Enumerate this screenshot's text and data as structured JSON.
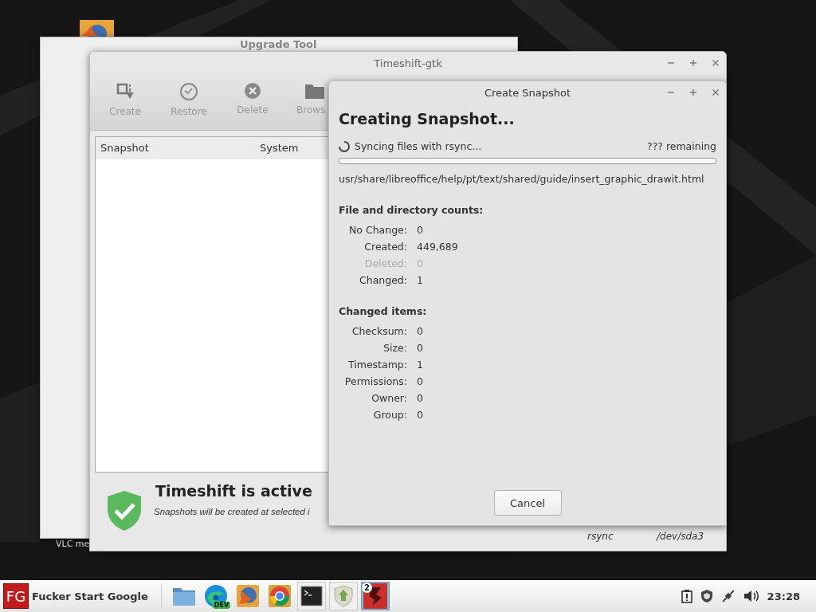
{
  "desktop": {
    "icons": [
      {
        "label": "VLC me"
      }
    ]
  },
  "upgrade_window": {
    "title": "Upgrade Tool"
  },
  "timeshift_window": {
    "title": "Timeshift-gtk",
    "toolbar": [
      {
        "kind": "create",
        "label": "Create",
        "disabled": true
      },
      {
        "kind": "restore",
        "label": "Restore",
        "disabled": true
      },
      {
        "kind": "delete",
        "label": "Delete",
        "disabled": true
      },
      {
        "kind": "browse",
        "label": "Brows",
        "disabled": true
      }
    ],
    "table": {
      "columns": [
        "Snapshot",
        "System"
      ]
    },
    "status": {
      "title": "Timeshift is active",
      "message": "Snapshots will be created at selected i",
      "mode": "rsync",
      "device": "/dev/sda3"
    }
  },
  "dialog": {
    "title": "Create Snapshot",
    "heading": "Creating Snapshot...",
    "activity": "Syncing files with rsync...",
    "remaining": "??? remaining",
    "progress": {
      "level": 0
    },
    "current_file": "usr/share/libreoffice/help/pt/text/shared/guide/insert_graphic_drawit.html",
    "sections": [
      {
        "title": "File and directory counts:",
        "rows": [
          {
            "label": "No Change:",
            "value": "0",
            "disabled": false
          },
          {
            "label": "Created:",
            "value": "449,689",
            "disabled": false
          },
          {
            "label": "Deleted:",
            "value": "0",
            "disabled": true
          },
          {
            "label": "Changed:",
            "value": "1",
            "disabled": false
          }
        ]
      },
      {
        "title": "Changed items:",
        "rows": [
          {
            "label": "Checksum:",
            "value": "0",
            "disabled": false
          },
          {
            "label": "Size:",
            "value": "0",
            "disabled": false
          },
          {
            "label": "Timestamp:",
            "value": "1",
            "disabled": false
          },
          {
            "label": "Permissions:",
            "value": "0",
            "disabled": false
          },
          {
            "label": "Owner:",
            "value": "0",
            "disabled": false
          },
          {
            "label": "Group:",
            "value": "0",
            "disabled": false
          }
        ]
      }
    ],
    "buttons": [
      "Cancel"
    ]
  },
  "taskbar": {
    "start": {
      "logo": "FG",
      "label": "Fucker Start Google"
    },
    "launchers": [
      {
        "kind": "folder",
        "running": false,
        "selected": false
      },
      {
        "kind": "edge",
        "badge": "DEV",
        "running": false,
        "selected": false
      },
      {
        "kind": "firefox",
        "running": false,
        "selected": false
      },
      {
        "kind": "chrome",
        "running": false,
        "selected": false
      },
      {
        "kind": "terminal",
        "running": true,
        "selected": false
      },
      {
        "kind": "updater",
        "running": true,
        "selected": false
      },
      {
        "kind": "app",
        "count": "2",
        "running": true,
        "selected": true
      }
    ],
    "tray": [
      {
        "kind": "clipboard"
      },
      {
        "kind": "shield"
      },
      {
        "kind": "network"
      },
      {
        "kind": "volume"
      }
    ],
    "clock": "23:28"
  }
}
